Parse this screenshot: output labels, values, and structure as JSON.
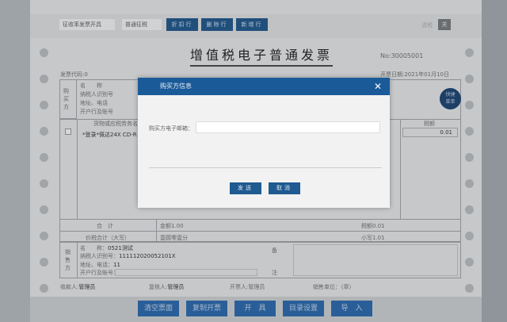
{
  "toolbar": {
    "invoice_mode": "征收率发票开具",
    "tax_type": "普通征税",
    "buttons": [
      "折扣行",
      "删除行",
      "新增行"
    ],
    "right_labels": [
      "清税",
      "关"
    ]
  },
  "invoice": {
    "title": "增值税电子普通发票",
    "number": "No:30005001",
    "code": "发票代码:0",
    "date": "开票日期:2021年01月10日"
  },
  "buyer": {
    "section": "购买方",
    "labels": [
      "名　　称",
      "纳税人识别号",
      "地址、电话",
      "开户行及账号"
    ]
  },
  "items": {
    "header_name": "货物或应税劳务名称",
    "header_tax": "税额",
    "row_name": "*登录*佩达24X CD-R",
    "row_tax": "0.01"
  },
  "totals": {
    "label": "合　计",
    "amount": "金额1.00",
    "tax": "税额0.01",
    "grand_label": "价税合计（大写）",
    "grand_text": "壹圆零壹分",
    "grand_small": "小写1.01"
  },
  "seller": {
    "section": "销售方",
    "name_label": "名　　称：",
    "name": "0521测试",
    "taxid_label": "纳税人识别号：",
    "taxid": "111112020052101X",
    "addr_label": "地址、电话：",
    "addr": "11",
    "bank_label": "开户行及账号：",
    "remark_1": "备",
    "remark_2": "注"
  },
  "footer": {
    "payee_label": "收款人:",
    "payee": "管理员",
    "reviewer_label": "复核人:",
    "reviewer": "管理员",
    "drawer": "开票人:管理员",
    "seller_unit": "销售单位：（章）"
  },
  "bottom_buttons": [
    "清空票面",
    "复制开票",
    "开　具",
    "目录设置",
    "导　入"
  ],
  "quick_menu": [
    "快捷",
    "菜单"
  ],
  "modal": {
    "title": "购买方信息",
    "email_label": "购买方电子邮箱：",
    "email_value": "",
    "send": "发送",
    "cancel": "取消",
    "close": "✕"
  }
}
